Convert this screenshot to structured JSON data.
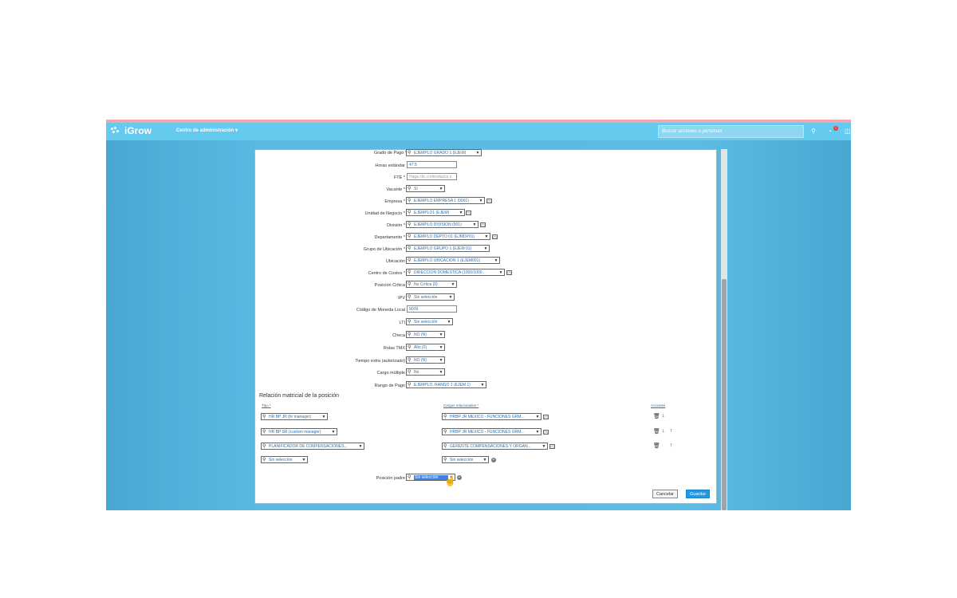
{
  "app": {
    "logo": "iGrow",
    "admin_menu": "Centro de administración",
    "search_placeholder": "Buscar acciones o personas",
    "notif_count": "1"
  },
  "form": {
    "grado_de_pago": {
      "label": "Grado de Pago *",
      "value": "EJEMPLO GRADO 1 (EJEM)"
    },
    "horas_estandar": {
      "label": "Horas estándar",
      "value": "47.5"
    },
    "fte": {
      "label": "FTE *",
      "placeholder": "Haga clic o introduzca u"
    },
    "vacante": {
      "label": "Vacante *",
      "value": "Sí"
    },
    "empresa": {
      "label": "Empresa *",
      "value": "EJEMPLO EMPRESA 1 (0001)"
    },
    "unidad_negocio": {
      "label": "Unidad de Negocio *",
      "value": "EJEMPLO1 (EJEM)"
    },
    "division": {
      "label": "División *",
      "value": "EJEMPLO DIVISION (001)"
    },
    "departamento": {
      "label": "Departamento *",
      "value": "EJEMPLO DEPTO 01 (EJMDP01)"
    },
    "grupo_ubicacion": {
      "label": "Grupo de Ubicación *",
      "value": "EJEMPLO GRUPO 1 (EJEM 01)"
    },
    "ubicacion": {
      "label": "Ubicación",
      "value": "EJEMPLO UBICACION 1 (EJEM001)"
    },
    "centro_costos": {
      "label": "Centro de Costos *",
      "value": "DIRECCION DOMESTICA (1000/1000..."
    },
    "posicion_critica": {
      "label": "Posición Crítica",
      "value": "No Crítica (0)"
    },
    "ipv": {
      "label": "IPV",
      "value": "Sin selección"
    },
    "codigo_moneda": {
      "label": "Código de Moneda Local",
      "value": "MXN"
    },
    "lti": {
      "label": "LTI",
      "value": "Sin selección"
    },
    "checa": {
      "label": "Checa",
      "value": "NO (N)"
    },
    "rolas_tmx": {
      "label": "Rolas TMX",
      "value": "Alto (0)"
    },
    "tiempo_extra": {
      "label": "Tiempo extra (autorizado)",
      "value": "NO (N)"
    },
    "cargo_multiple": {
      "label": "Cargo múltiple",
      "value": "No"
    },
    "rango_pago": {
      "label": "Rango de Pago",
      "value": "EJEMPLO, RANGO 1 (EJEM 1)"
    }
  },
  "matrix": {
    "title": "Relación matricial de la posición",
    "col_tipo": "Tipo *",
    "col_cargos": "Cargos relacionados *",
    "col_acciones": "Acciones",
    "rows": [
      {
        "tipo": "HR BP JR (hr manager)",
        "cargo": "HRBP JR MEXICO - FUNCIONES GRM..."
      },
      {
        "tipo": "HR BP SR (custom manager)",
        "cargo": "HRBP JR MEXICO - FUNCIONES GRM..."
      },
      {
        "tipo": "PLANIFICADOR DE COMPENSACIONES...",
        "cargo": "GERENTE COMPENSACIONES Y ORGAN..."
      },
      {
        "tipo": "Sin selección",
        "cargo": "Sin selección"
      }
    ]
  },
  "posicion_padre": {
    "label": "Posición padre",
    "value": "Sin selección"
  },
  "buttons": {
    "cancel": "Cancelar",
    "save": "Guardar"
  },
  "icons": {
    "search": "search-icon",
    "caret": "chevron-down-icon",
    "trash": "trash-icon",
    "down": "arrow-down-icon",
    "up": "arrow-up-icon",
    "add": "plus-circle-icon",
    "cursor": "hand-cursor-icon"
  },
  "colors": {
    "topbar": "#64cbef",
    "accent": "#1f9be6",
    "highlight": "#3f82e6"
  }
}
